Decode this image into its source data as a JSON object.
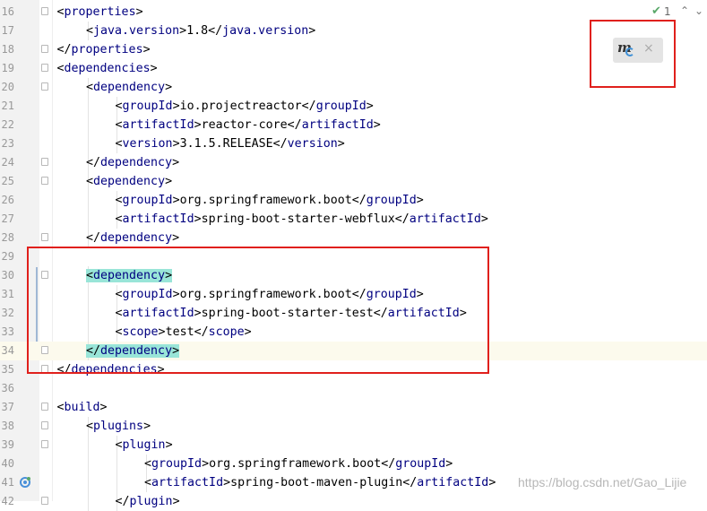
{
  "editor": {
    "lines": [
      {
        "num": "16",
        "indent": 1,
        "open": "properties"
      },
      {
        "num": "17",
        "indent": 2,
        "tag": "java.version",
        "text": "1.8"
      },
      {
        "num": "18",
        "indent": 1,
        "close": "properties"
      },
      {
        "num": "19",
        "indent": 1,
        "open": "dependencies"
      },
      {
        "num": "20",
        "indent": 2,
        "open": "dependency"
      },
      {
        "num": "21",
        "indent": 3,
        "tag": "groupId",
        "text": "io.projectreactor"
      },
      {
        "num": "22",
        "indent": 3,
        "tag": "artifactId",
        "text": "reactor-core"
      },
      {
        "num": "23",
        "indent": 3,
        "tag": "version",
        "text": "3.1.5.RELEASE"
      },
      {
        "num": "24",
        "indent": 2,
        "close": "dependency"
      },
      {
        "num": "25",
        "indent": 2,
        "open": "dependency"
      },
      {
        "num": "26",
        "indent": 3,
        "tag": "groupId",
        "text": "org.springframework.boot"
      },
      {
        "num": "27",
        "indent": 3,
        "tag": "artifactId",
        "text": "spring-boot-starter-webflux"
      },
      {
        "num": "28",
        "indent": 2,
        "close": "dependency"
      },
      {
        "num": "29",
        "indent": 0
      },
      {
        "num": "30",
        "indent": 2,
        "open": "dependency",
        "highlight": true
      },
      {
        "num": "31",
        "indent": 3,
        "tag": "groupId",
        "text": "org.springframework.boot"
      },
      {
        "num": "32",
        "indent": 3,
        "tag": "artifactId",
        "text": "spring-boot-starter-test"
      },
      {
        "num": "33",
        "indent": 3,
        "tag": "scope",
        "text": "test"
      },
      {
        "num": "34",
        "indent": 2,
        "close": "dependency",
        "highlight": true,
        "current": true
      },
      {
        "num": "35",
        "indent": 1,
        "close": "dependencies"
      },
      {
        "num": "36",
        "indent": 0
      },
      {
        "num": "37",
        "indent": 1,
        "open": "build"
      },
      {
        "num": "38",
        "indent": 2,
        "open": "plugins"
      },
      {
        "num": "39",
        "indent": 3,
        "open": "plugin"
      },
      {
        "num": "40",
        "indent": 4,
        "tag": "groupId",
        "text": "org.springframework.boot"
      },
      {
        "num": "41",
        "indent": 4,
        "tag": "artifactId",
        "text": "spring-boot-maven-plugin"
      },
      {
        "num": "42",
        "indent": 3,
        "close": "plugin"
      }
    ]
  },
  "inspection": {
    "count": "1",
    "status_color": "#59a869"
  },
  "maven_popup": {
    "icon": "maven-reload-icon",
    "close_glyph": "×"
  },
  "watermark": "https://blog.csdn.net/Gao_Lijie",
  "colors": {
    "tag": "#000080",
    "tag_highlight": "#99e5d8",
    "annotation_box": "#e0201c",
    "current_line": "#fcfaed"
  }
}
